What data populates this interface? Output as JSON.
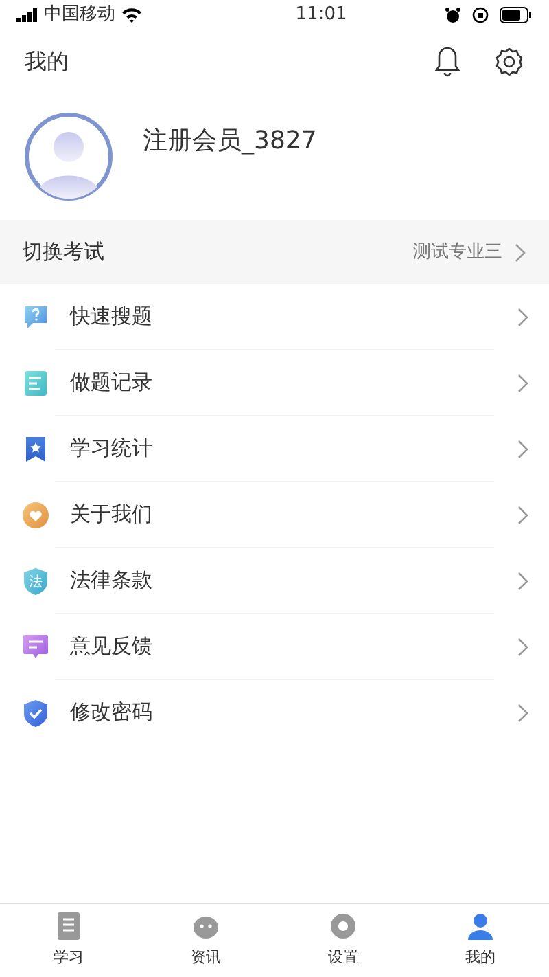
{
  "status_bar": {
    "carrier": "中国移动",
    "time": "11:01"
  },
  "header": {
    "title": "我的"
  },
  "profile": {
    "name": "注册会员_3827"
  },
  "switch_exam": {
    "label": "切换考试",
    "value": "测试专业三"
  },
  "menu": [
    {
      "kind": "question",
      "label": "快速搜题"
    },
    {
      "kind": "record",
      "label": "做题记录"
    },
    {
      "kind": "bookmark",
      "label": "学习统计"
    },
    {
      "kind": "heart",
      "label": "关于我们"
    },
    {
      "kind": "shield-text",
      "label": "法律条款",
      "icon_text": "法"
    },
    {
      "kind": "message",
      "label": "意见反馈"
    },
    {
      "kind": "shield-check",
      "label": "修改密码"
    }
  ],
  "tab_bar": [
    {
      "kind": "book",
      "label": "学习",
      "selected": false
    },
    {
      "kind": "news",
      "label": "资讯",
      "selected": false
    },
    {
      "kind": "settings",
      "label": "设置",
      "selected": false
    },
    {
      "kind": "person",
      "label": "我的",
      "selected": true
    }
  ]
}
